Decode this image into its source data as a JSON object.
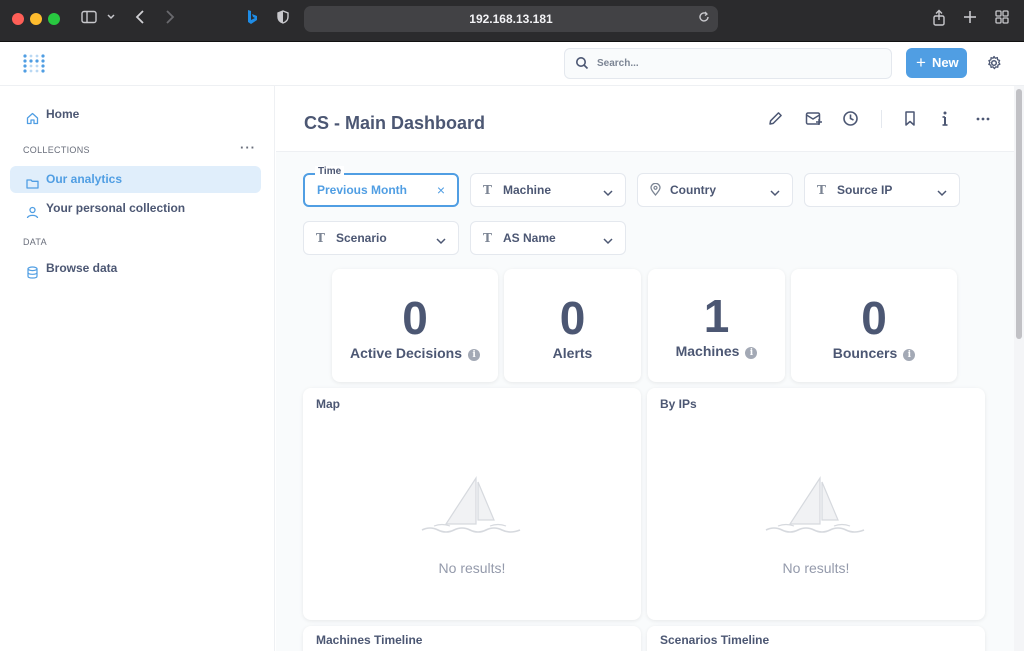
{
  "browser": {
    "url": "192.168.13.181"
  },
  "header": {
    "search_placeholder": "Search...",
    "new_label": "New"
  },
  "sidebar": {
    "home": "Home",
    "collections_heading": "COLLECTIONS",
    "collections": [
      {
        "label": "Our analytics",
        "active": true
      },
      {
        "label": "Your personal collection",
        "active": false
      }
    ],
    "data_heading": "DATA",
    "browse_data": "Browse data"
  },
  "dashboard": {
    "title": "CS - Main Dashboard",
    "filters": {
      "time_legend": "Time",
      "time_value": "Previous Month",
      "machine": "Machine",
      "country": "Country",
      "source_ip": "Source IP",
      "scenario": "Scenario",
      "as_name": "AS Name"
    },
    "stats": [
      {
        "value": "0",
        "label": "Active Decisions"
      },
      {
        "value": "0",
        "label": "Alerts"
      },
      {
        "value": "1",
        "label": "Machines"
      },
      {
        "value": "0",
        "label": "Bouncers"
      }
    ],
    "panels": {
      "map": "Map",
      "by_ips": "By IPs",
      "no_results": "No results!",
      "machines_timeline": "Machines Timeline",
      "scenarios_timeline": "Scenarios Timeline"
    }
  },
  "colors": {
    "accent": "#509ee3",
    "text": "#4c5773",
    "active_bg": "#e0eefb"
  }
}
